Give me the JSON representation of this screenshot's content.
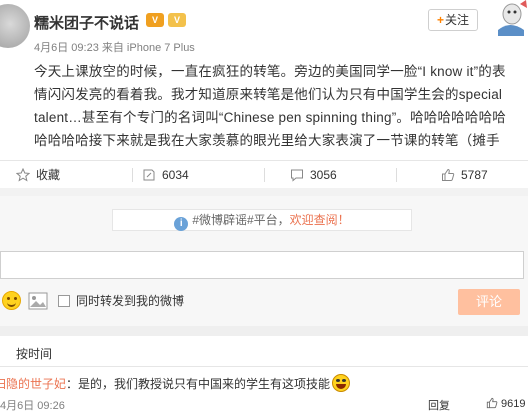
{
  "post": {
    "author": "糯米团子不说话",
    "vip_badge_1": "V",
    "vip_badge_2": "V",
    "meta": "4月6日 09:23 来自 iPhone 7 Plus",
    "follow": {
      "plus": "+",
      "label": "关注"
    },
    "text": "今天上课放空的时候，一直在疯狂的转笔。旁边的美国同学一脸“I know it”的表情闪闪发亮的看着我。我才知道原来转笔是他们认为只有中国学生会的special talent…甚至有个专门的名词叫“Chinese pen spinning thing”。哈哈哈哈哈哈哈哈哈哈哈接下来就是我在大家羡慕的眼光里给大家表演了一节课的转笔（摊手"
  },
  "actions": {
    "favorite": "收藏",
    "repost": "6034",
    "comment": "3056",
    "like": "5787"
  },
  "comment_box": {
    "rumor_tag": "#微博辟谣#平台，",
    "rumor_welcome": "欢迎查阅！",
    "rumor_info": "i",
    "input_value": "",
    "repost_label": "同时转发到我的微博",
    "submit": "评论"
  },
  "comments": {
    "sort": "按时间",
    "items": [
      {
        "user": "归隐的世子妃",
        "text": "：是的，我们教授说只有中国来的学生有这项技能",
        "time": "4月6日 09:26",
        "reply": "回复",
        "likes": "9619"
      }
    ]
  },
  "colors": {
    "accent": "#ff8200",
    "link": "#eb7350",
    "button_disabled": "#ffc09f"
  }
}
